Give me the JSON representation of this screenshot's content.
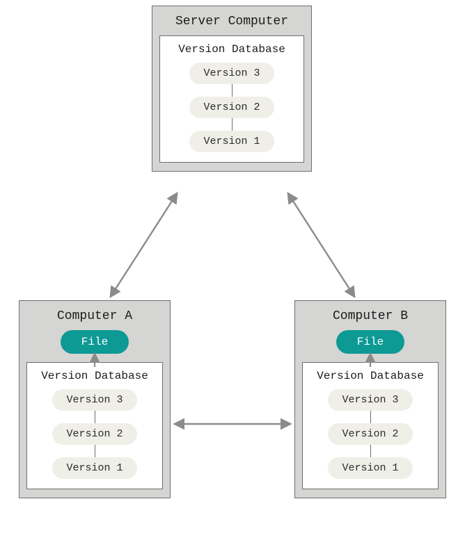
{
  "server": {
    "title": "Server Computer",
    "db_title": "Version Database",
    "versions": [
      "Version 3",
      "Version 2",
      "Version 1"
    ]
  },
  "computer_a": {
    "title": "Computer A",
    "file_label": "File",
    "db_title": "Version Database",
    "versions": [
      "Version 3",
      "Version 2",
      "Version 1"
    ]
  },
  "computer_b": {
    "title": "Computer B",
    "file_label": "File",
    "db_title": "Version Database",
    "versions": [
      "Version 3",
      "Version 2",
      "Version 1"
    ]
  }
}
